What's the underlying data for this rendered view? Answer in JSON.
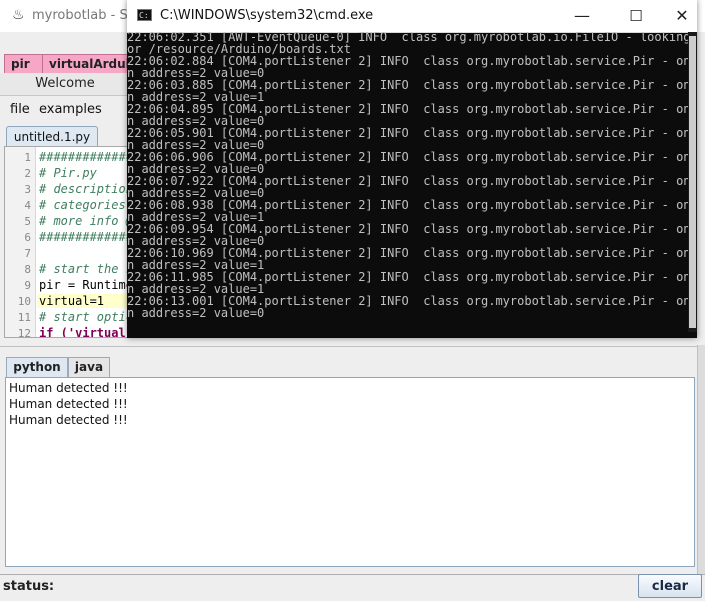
{
  "swing_window": {
    "title": "myrobotlab - Swin",
    "tabs": [
      {
        "label": "pir"
      },
      {
        "label": "virtualArduino"
      }
    ],
    "welcome_label": "Welcome",
    "menu": [
      {
        "label": "file"
      },
      {
        "label": "examples"
      }
    ],
    "file_tab": "untitled.1.py",
    "editor_lines": [
      {
        "num": "1",
        "text": "##############"
      },
      {
        "num": "2",
        "text": "# Pir.py"
      },
      {
        "num": "3",
        "text": "# description:"
      },
      {
        "num": "4",
        "text": "# categories:"
      },
      {
        "num": "5",
        "text": "# more info @"
      },
      {
        "num": "6",
        "text": "##############"
      },
      {
        "num": "7",
        "text": ""
      },
      {
        "num": "8",
        "text": "# start the s"
      },
      {
        "num": "9",
        "text": "pir = Runtime"
      },
      {
        "num": "10",
        "text": "virtual=1"
      },
      {
        "num": "11",
        "text": "# start optic"
      },
      {
        "num": "12",
        "text": "if ('virtual' in globals() and virtual):"
      }
    ],
    "bottom_tabs": [
      {
        "label": "python"
      },
      {
        "label": "java"
      }
    ],
    "output_lines": [
      "Human detected !!!",
      "Human detected !!!",
      "Human detected !!!"
    ],
    "status_label": "status:",
    "clear_label": "clear"
  },
  "cmd_window": {
    "title": "C:\\WINDOWS\\system32\\cmd.exe",
    "minimize_glyph": "—",
    "maximize_glyph": "☐",
    "close_glyph": "✕",
    "lines": [
      "22:06:02.351 [AWT-EventQueue-0] INFO  class org.myrobotlab.io.FileIO - looking f",
      "or /resource/Arduino/boards.txt",
      "22:06:02.884 [COM4.portListener 2] INFO  class org.myrobotlab.service.Pir - onPi",
      "n address=2 value=0",
      "22:06:03.885 [COM4.portListener 2] INFO  class org.myrobotlab.service.Pir - onPi",
      "n address=2 value=1",
      "22:06:04.895 [COM4.portListener 2] INFO  class org.myrobotlab.service.Pir - onPi",
      "n address=2 value=0",
      "22:06:05.901 [COM4.portListener 2] INFO  class org.myrobotlab.service.Pir - onPi",
      "n address=2 value=0",
      "22:06:06.906 [COM4.portListener 2] INFO  class org.myrobotlab.service.Pir - onPi",
      "n address=2 value=0",
      "22:06:07.922 [COM4.portListener 2] INFO  class org.myrobotlab.service.Pir - onPi",
      "n address=2 value=0",
      "22:06:08.938 [COM4.portListener 2] INFO  class org.myrobotlab.service.Pir - onPi",
      "n address=2 value=1",
      "22:06:09.954 [COM4.portListener 2] INFO  class org.myrobotlab.service.Pir - onPi",
      "n address=2 value=0",
      "22:06:10.969 [COM4.portListener 2] INFO  class org.myrobotlab.service.Pir - onPi",
      "n address=2 value=1",
      "22:06:11.985 [COM4.portListener 2] INFO  class org.myrobotlab.service.Pir - onPi",
      "n address=2 value=1",
      "22:06:13.001 [COM4.portListener 2] INFO  class org.myrobotlab.service.Pir - onPi",
      "n address=2 value=0"
    ]
  }
}
